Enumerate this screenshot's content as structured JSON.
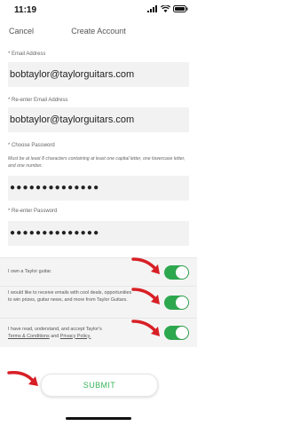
{
  "status": {
    "time": "11:19"
  },
  "nav": {
    "cancel_label": "Cancel",
    "title": "Create Account"
  },
  "form": {
    "email_label": "* Email Address",
    "email_value": "bobtaylor@taylorguitars.com",
    "reemail_label": "* Re-enter Email Address",
    "reemail_value": "bobtaylor@taylorguitars.com",
    "password_label": "* Choose Password",
    "password_hint": "Must be at least 8 characters containing at least one capital letter, one lowercase letter, and one number.",
    "password_value": "●●●●●●●●●●●●●●",
    "repassword_label": "* Re-enter Password",
    "repassword_value": "●●●●●●●●●●●●●●"
  },
  "toggles": {
    "own_guitar": {
      "label": "I own a Taylor guitar.",
      "on": true
    },
    "emails": {
      "label": "I would like to receive emails with cool deals, opportunities to win prizes, guitar news, and more from Taylor Guitars.",
      "on": true
    },
    "terms": {
      "label_prefix": "I have read, understand, and accept Taylor's",
      "terms_link": "Terms & Conditions",
      "and_text": "and",
      "privacy_link": "Privacy Policy.",
      "on": true
    }
  },
  "submit_label": "SUBMIT",
  "colors": {
    "toggle_on": "#2ea84f",
    "submit_text": "#35b35a",
    "arrow": "#d81f26"
  }
}
